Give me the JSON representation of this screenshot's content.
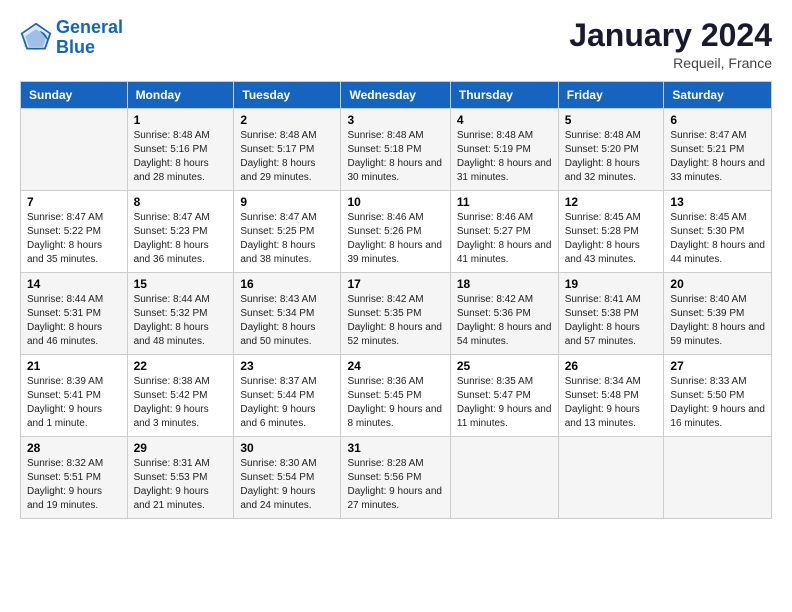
{
  "logo": {
    "line1": "General",
    "line2": "Blue"
  },
  "title": "January 2024",
  "location": "Requeil, France",
  "days_header": [
    "Sunday",
    "Monday",
    "Tuesday",
    "Wednesday",
    "Thursday",
    "Friday",
    "Saturday"
  ],
  "weeks": [
    [
      {
        "num": "",
        "sunrise": "",
        "sunset": "",
        "daylight": ""
      },
      {
        "num": "1",
        "sunrise": "Sunrise: 8:48 AM",
        "sunset": "Sunset: 5:16 PM",
        "daylight": "Daylight: 8 hours and 28 minutes."
      },
      {
        "num": "2",
        "sunrise": "Sunrise: 8:48 AM",
        "sunset": "Sunset: 5:17 PM",
        "daylight": "Daylight: 8 hours and 29 minutes."
      },
      {
        "num": "3",
        "sunrise": "Sunrise: 8:48 AM",
        "sunset": "Sunset: 5:18 PM",
        "daylight": "Daylight: 8 hours and 30 minutes."
      },
      {
        "num": "4",
        "sunrise": "Sunrise: 8:48 AM",
        "sunset": "Sunset: 5:19 PM",
        "daylight": "Daylight: 8 hours and 31 minutes."
      },
      {
        "num": "5",
        "sunrise": "Sunrise: 8:48 AM",
        "sunset": "Sunset: 5:20 PM",
        "daylight": "Daylight: 8 hours and 32 minutes."
      },
      {
        "num": "6",
        "sunrise": "Sunrise: 8:47 AM",
        "sunset": "Sunset: 5:21 PM",
        "daylight": "Daylight: 8 hours and 33 minutes."
      }
    ],
    [
      {
        "num": "7",
        "sunrise": "Sunrise: 8:47 AM",
        "sunset": "Sunset: 5:22 PM",
        "daylight": "Daylight: 8 hours and 35 minutes."
      },
      {
        "num": "8",
        "sunrise": "Sunrise: 8:47 AM",
        "sunset": "Sunset: 5:23 PM",
        "daylight": "Daylight: 8 hours and 36 minutes."
      },
      {
        "num": "9",
        "sunrise": "Sunrise: 8:47 AM",
        "sunset": "Sunset: 5:25 PM",
        "daylight": "Daylight: 8 hours and 38 minutes."
      },
      {
        "num": "10",
        "sunrise": "Sunrise: 8:46 AM",
        "sunset": "Sunset: 5:26 PM",
        "daylight": "Daylight: 8 hours and 39 minutes."
      },
      {
        "num": "11",
        "sunrise": "Sunrise: 8:46 AM",
        "sunset": "Sunset: 5:27 PM",
        "daylight": "Daylight: 8 hours and 41 minutes."
      },
      {
        "num": "12",
        "sunrise": "Sunrise: 8:45 AM",
        "sunset": "Sunset: 5:28 PM",
        "daylight": "Daylight: 8 hours and 43 minutes."
      },
      {
        "num": "13",
        "sunrise": "Sunrise: 8:45 AM",
        "sunset": "Sunset: 5:30 PM",
        "daylight": "Daylight: 8 hours and 44 minutes."
      }
    ],
    [
      {
        "num": "14",
        "sunrise": "Sunrise: 8:44 AM",
        "sunset": "Sunset: 5:31 PM",
        "daylight": "Daylight: 8 hours and 46 minutes."
      },
      {
        "num": "15",
        "sunrise": "Sunrise: 8:44 AM",
        "sunset": "Sunset: 5:32 PM",
        "daylight": "Daylight: 8 hours and 48 minutes."
      },
      {
        "num": "16",
        "sunrise": "Sunrise: 8:43 AM",
        "sunset": "Sunset: 5:34 PM",
        "daylight": "Daylight: 8 hours and 50 minutes."
      },
      {
        "num": "17",
        "sunrise": "Sunrise: 8:42 AM",
        "sunset": "Sunset: 5:35 PM",
        "daylight": "Daylight: 8 hours and 52 minutes."
      },
      {
        "num": "18",
        "sunrise": "Sunrise: 8:42 AM",
        "sunset": "Sunset: 5:36 PM",
        "daylight": "Daylight: 8 hours and 54 minutes."
      },
      {
        "num": "19",
        "sunrise": "Sunrise: 8:41 AM",
        "sunset": "Sunset: 5:38 PM",
        "daylight": "Daylight: 8 hours and 57 minutes."
      },
      {
        "num": "20",
        "sunrise": "Sunrise: 8:40 AM",
        "sunset": "Sunset: 5:39 PM",
        "daylight": "Daylight: 8 hours and 59 minutes."
      }
    ],
    [
      {
        "num": "21",
        "sunrise": "Sunrise: 8:39 AM",
        "sunset": "Sunset: 5:41 PM",
        "daylight": "Daylight: 9 hours and 1 minute."
      },
      {
        "num": "22",
        "sunrise": "Sunrise: 8:38 AM",
        "sunset": "Sunset: 5:42 PM",
        "daylight": "Daylight: 9 hours and 3 minutes."
      },
      {
        "num": "23",
        "sunrise": "Sunrise: 8:37 AM",
        "sunset": "Sunset: 5:44 PM",
        "daylight": "Daylight: 9 hours and 6 minutes."
      },
      {
        "num": "24",
        "sunrise": "Sunrise: 8:36 AM",
        "sunset": "Sunset: 5:45 PM",
        "daylight": "Daylight: 9 hours and 8 minutes."
      },
      {
        "num": "25",
        "sunrise": "Sunrise: 8:35 AM",
        "sunset": "Sunset: 5:47 PM",
        "daylight": "Daylight: 9 hours and 11 minutes."
      },
      {
        "num": "26",
        "sunrise": "Sunrise: 8:34 AM",
        "sunset": "Sunset: 5:48 PM",
        "daylight": "Daylight: 9 hours and 13 minutes."
      },
      {
        "num": "27",
        "sunrise": "Sunrise: 8:33 AM",
        "sunset": "Sunset: 5:50 PM",
        "daylight": "Daylight: 9 hours and 16 minutes."
      }
    ],
    [
      {
        "num": "28",
        "sunrise": "Sunrise: 8:32 AM",
        "sunset": "Sunset: 5:51 PM",
        "daylight": "Daylight: 9 hours and 19 minutes."
      },
      {
        "num": "29",
        "sunrise": "Sunrise: 8:31 AM",
        "sunset": "Sunset: 5:53 PM",
        "daylight": "Daylight: 9 hours and 21 minutes."
      },
      {
        "num": "30",
        "sunrise": "Sunrise: 8:30 AM",
        "sunset": "Sunset: 5:54 PM",
        "daylight": "Daylight: 9 hours and 24 minutes."
      },
      {
        "num": "31",
        "sunrise": "Sunrise: 8:28 AM",
        "sunset": "Sunset: 5:56 PM",
        "daylight": "Daylight: 9 hours and 27 minutes."
      },
      {
        "num": "",
        "sunrise": "",
        "sunset": "",
        "daylight": ""
      },
      {
        "num": "",
        "sunrise": "",
        "sunset": "",
        "daylight": ""
      },
      {
        "num": "",
        "sunrise": "",
        "sunset": "",
        "daylight": ""
      }
    ]
  ]
}
